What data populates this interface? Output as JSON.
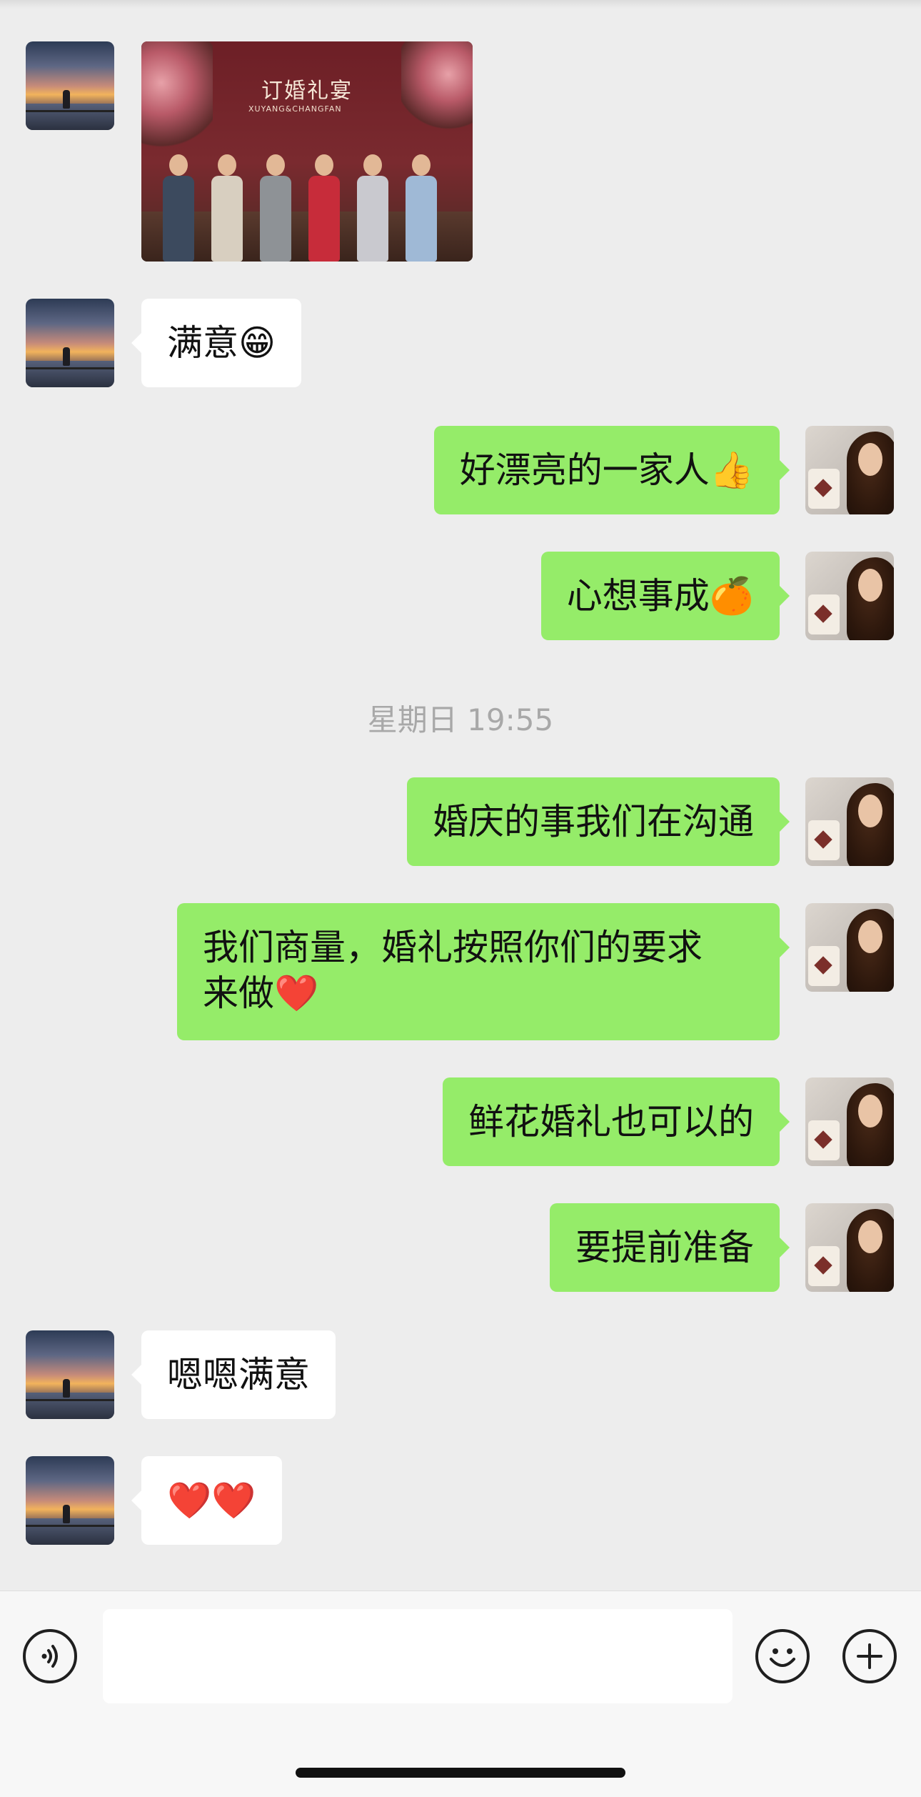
{
  "messages": [
    {
      "id": "m1",
      "side": "left",
      "type": "image",
      "photo": {
        "title": "订婚礼宴",
        "subtitle": "XUYANG&CHANGFAN"
      }
    },
    {
      "id": "m2",
      "side": "left",
      "type": "text",
      "text": "满意😁"
    },
    {
      "id": "m3",
      "side": "right",
      "type": "text",
      "text": "好漂亮的一家人👍"
    },
    {
      "id": "m4",
      "side": "right",
      "type": "text",
      "text": "心想事成🍊"
    },
    {
      "id": "ts",
      "type": "timestamp",
      "text": "星期日 19:55"
    },
    {
      "id": "m5",
      "side": "right",
      "type": "text",
      "text": "婚庆的事我们在沟通"
    },
    {
      "id": "m6",
      "side": "right",
      "type": "text",
      "line1": "我们商量，婚礼按照你们的要求",
      "line2": "来做❤️"
    },
    {
      "id": "m7",
      "side": "right",
      "type": "text",
      "text": "鲜花婚礼也可以的"
    },
    {
      "id": "m8",
      "side": "right",
      "type": "text",
      "text": "要提前准备"
    },
    {
      "id": "m9",
      "side": "left",
      "type": "text",
      "text": "嗯嗯满意"
    },
    {
      "id": "m10",
      "side": "left",
      "type": "text",
      "text": "❤️❤️"
    }
  ],
  "input_bar": {
    "placeholder": "",
    "left_icon": "voice-icon",
    "right_icons": [
      "emoji-icon",
      "plus-icon"
    ]
  },
  "colors": {
    "background": "#ededed",
    "outgoing_bubble": "#95ec69",
    "incoming_bubble": "#ffffff",
    "timestamp": "#a8a8a8"
  }
}
